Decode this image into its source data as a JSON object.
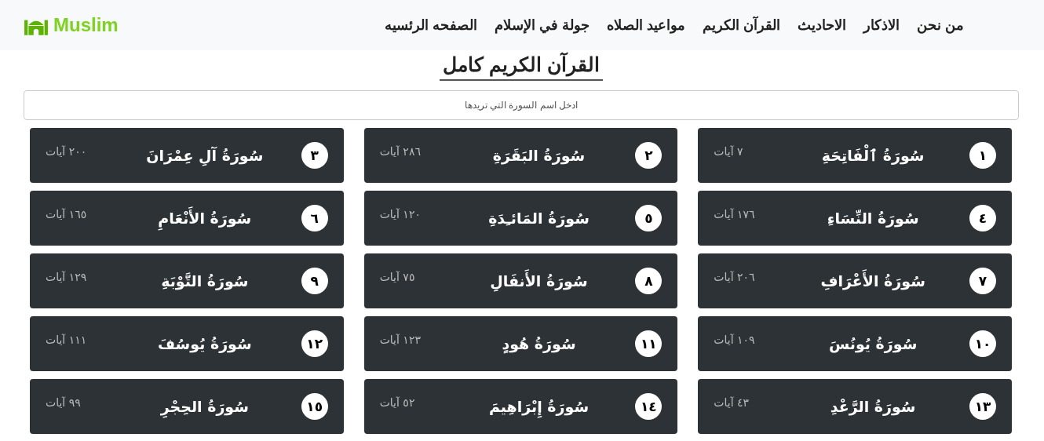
{
  "logo": {
    "text": "Muslim"
  },
  "nav": [
    {
      "label": "من نحن"
    },
    {
      "label": "الاذكار"
    },
    {
      "label": "الاحاديث"
    },
    {
      "label": "القرآن الكريم"
    },
    {
      "label": "مواعيد الصلاه"
    },
    {
      "label": "جولة في الإسلام"
    },
    {
      "label": "الصفحه الرئسيه"
    }
  ],
  "heading": "القرآن الكريم كامل",
  "search": {
    "placeholder": "ادخل اسم السورة التي تريدها"
  },
  "surahs": [
    {
      "number": "١",
      "name": "سُورَةُ ٱلْفَاتِحَةِ",
      "ayat": "٧ آيات"
    },
    {
      "number": "٢",
      "name": "سُورَةُ البَقَرَةِ",
      "ayat": "٢٨٦ آيات"
    },
    {
      "number": "٣",
      "name": "سُورَةُ آلِ عِمْرَانَ",
      "ayat": "٢٠٠ آيات"
    },
    {
      "number": "٤",
      "name": "سُورَةُ النِّسَاءِ",
      "ayat": "١٧٦ آيات"
    },
    {
      "number": "٥",
      "name": "سُورَةُ المَائـِدَةِ",
      "ayat": "١٢٠ آيات"
    },
    {
      "number": "٦",
      "name": "سُورَةُ الأَنْعَامِ",
      "ayat": "١٦٥ آيات"
    },
    {
      "number": "٧",
      "name": "سُورَةُ الأَعْرَافِ",
      "ayat": "٢٠٦ آيات"
    },
    {
      "number": "٨",
      "name": "سُورَةُ الأَنفَالِ",
      "ayat": "٧٥ آيات"
    },
    {
      "number": "٩",
      "name": "سُورَةُ التَّوْبَةِ",
      "ayat": "١٢٩ آيات"
    },
    {
      "number": "١٠",
      "name": "سُورَةُ يُونُسَ",
      "ayat": "١٠٩ آيات"
    },
    {
      "number": "١١",
      "name": "سُورَةُ هُودٍ",
      "ayat": "١٢٣ آيات"
    },
    {
      "number": "١٢",
      "name": "سُورَةُ يُوسُفَ",
      "ayat": "١١١ آيات"
    },
    {
      "number": "١٣",
      "name": "سُورَةُ الرَّعْدِ",
      "ayat": "٤٣ آيات"
    },
    {
      "number": "١٤",
      "name": "سُورَةُ إِبْرَاهِيمَ",
      "ayat": "٥٢ آيات"
    },
    {
      "number": "١٥",
      "name": "سُورَةُ الحِجْرِ",
      "ayat": "٩٩ آيات"
    }
  ]
}
